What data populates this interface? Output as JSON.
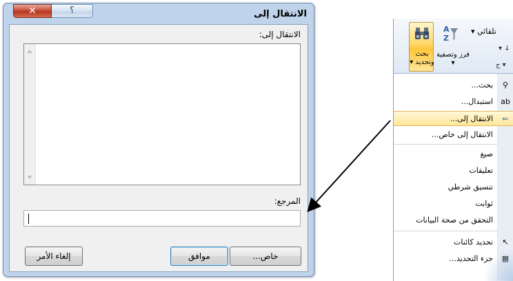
{
  "dialog": {
    "title": "الانتقال إلى",
    "close_glyph": "✕",
    "help_glyph": "؟",
    "goto_label": "الانتقال إلى:",
    "reference_label": "المرجع:",
    "reference_value": "",
    "buttons": {
      "special": "خاص...",
      "ok": "موافق",
      "cancel": "إلغاء الأمر"
    }
  },
  "ribbon": {
    "top_label": "تلقائي ▾",
    "frag1": "▾ ↓",
    "frag2": "ج ▾",
    "find_select_label": "بحث وتحديد ▾",
    "sort_filter_label": "فرز وتصفية ▾",
    "menu_items": [
      {
        "label": "بحث...",
        "icon": "binoculars-icon"
      },
      {
        "label": "استبدال...",
        "icon": "replace-icon"
      },
      {
        "label": "الانتقال إلى...",
        "icon": "goto-arrow-icon",
        "highlighted": true
      },
      {
        "label": "الانتقال إلى خاص...",
        "icon": ""
      },
      {
        "label": "صيغ",
        "icon": ""
      },
      {
        "label": "تعليقات",
        "icon": ""
      },
      {
        "label": "تنسيق شرطي",
        "icon": ""
      },
      {
        "label": "ثوابت",
        "icon": ""
      },
      {
        "label": "التحقق من صحة البيانات",
        "icon": ""
      },
      {
        "label": "تحديد كائنات",
        "icon": "select-objects-icon"
      },
      {
        "label": "جزء التحديد...",
        "icon": "selection-pane-icon"
      }
    ]
  },
  "colors": {
    "dialog_frame": "#bfd3ea",
    "close_button": "#c9503a",
    "highlight": "#ffe79a",
    "arrow": "#000000"
  }
}
